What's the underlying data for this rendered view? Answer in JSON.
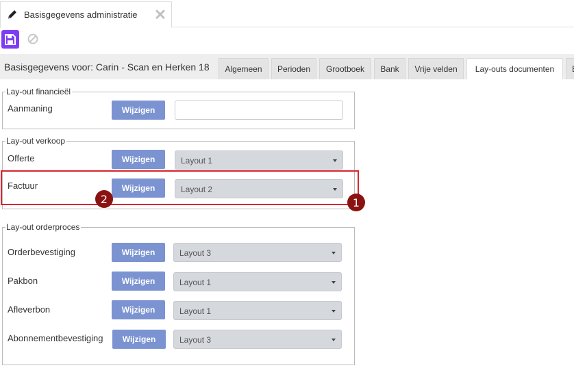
{
  "document_tab": {
    "title": "Basisgegevens administratie",
    "icon": "pencil-icon",
    "close_icon": "close-icon"
  },
  "toolbar": {
    "save_icon": "floppy-disk-icon",
    "cancel_icon": "cancel-icon",
    "accent": "#7d3cf5"
  },
  "header": {
    "title": "Basisgegevens voor: Carin - Scan en Herken 18",
    "tabs": [
      {
        "label": "Algemeen",
        "active": false
      },
      {
        "label": "Perioden",
        "active": false
      },
      {
        "label": "Grootboek",
        "active": false
      },
      {
        "label": "Bank",
        "active": false
      },
      {
        "label": "Vrije velden",
        "active": false
      },
      {
        "label": "Lay-outs documenten",
        "active": true
      },
      {
        "label": "B",
        "active": false
      }
    ]
  },
  "button_label": "Wijzigen",
  "button_color": "#7b93d1",
  "sections": {
    "financieel": {
      "legend": "Lay-out financieël",
      "rows": [
        {
          "label": "Aanmaning",
          "value": ""
        }
      ]
    },
    "verkoop": {
      "legend": "Lay-out verkoop",
      "rows": [
        {
          "label": "Offerte",
          "value": "Layout 1"
        },
        {
          "label": "Factuur",
          "value": "Layout 2"
        }
      ]
    },
    "orderproces": {
      "legend": "Lay-out orderproces",
      "rows": [
        {
          "label": "Orderbevestiging",
          "value": "Layout 3"
        },
        {
          "label": "Pakbon",
          "value": "Layout 1"
        },
        {
          "label": "Afleverbon",
          "value": "Layout 1"
        },
        {
          "label": "Abonnementbevestiging",
          "value": "Layout 3"
        }
      ]
    }
  },
  "annotations": {
    "highlight_color": "#d8242f",
    "marker_color": "#8b1212",
    "markers": [
      {
        "label": "1"
      },
      {
        "label": "2"
      }
    ]
  }
}
